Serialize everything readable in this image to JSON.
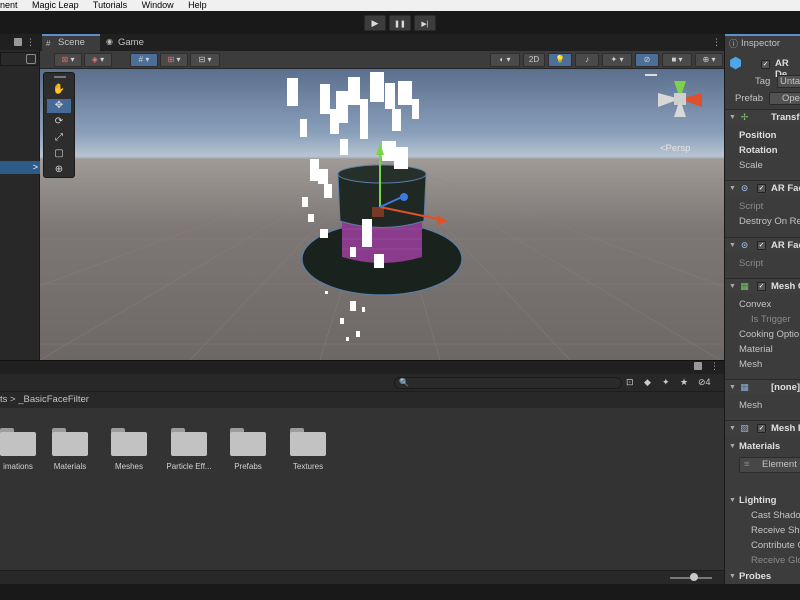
{
  "menubar": {
    "items": [
      "nent",
      "Magic Leap",
      "Tutorials",
      "Window",
      "Help"
    ]
  },
  "playbar": {
    "play_icon": "▶",
    "pause_icon": "❚❚",
    "step_icon": "▶|"
  },
  "hierarchy": {
    "selected_marker": ">"
  },
  "scene": {
    "tabs": [
      {
        "label": "Scene",
        "icon": "scene-icon"
      },
      {
        "label": "Game",
        "icon": "game-icon"
      }
    ],
    "toolbar": {
      "mode_2d": "2D"
    },
    "persp_label": "<Persp"
  },
  "tool_palette": [
    "view",
    "move",
    "rotate",
    "scale",
    "rect",
    "transform"
  ],
  "project": {
    "breadcrumb": "ts > _BasicFaceFilter",
    "search_placeholder": "",
    "visibility_count": "4",
    "folders": [
      "imations",
      "Materials",
      "Meshes",
      "Particle Eff...",
      "Prefabs",
      "Textures"
    ]
  },
  "inspector": {
    "tab_label": "Inspector",
    "object_name": "AR De",
    "tag_label": "Tag",
    "tag_value": "Unta",
    "prefab_label": "Prefab",
    "prefab_open": "Ope",
    "transform": {
      "header": "Transf",
      "position": "Position",
      "rotation": "Rotation",
      "scale": "Scale"
    },
    "ar_face_1": {
      "header": "AR Fac",
      "script": "Script",
      "destroy": "Destroy On Re"
    },
    "ar_face_2": {
      "header": "AR Fac",
      "script": "Script"
    },
    "mesh_collider": {
      "header": "Mesh C",
      "convex": "Convex",
      "is_trigger": "Is Trigger",
      "cooking": "Cooking Optio",
      "material": "Material",
      "mesh": "Mesh"
    },
    "mesh_filter": {
      "header": "[none]",
      "mesh": "Mesh"
    },
    "mesh_renderer": {
      "header": "Mesh R",
      "materials": "Materials",
      "element": "Element 0"
    },
    "lighting": {
      "header": "Lighting",
      "cast": "Cast Shado",
      "receive": "Receive Sh",
      "contribute": "Contribute G",
      "receive_gi": "Receive Glo"
    },
    "probes": {
      "header": "Probes"
    }
  },
  "colors": {
    "accent": "#4b6f98",
    "selection": "#2c5d87",
    "hat_band": "#8a3b8c",
    "hat_body": "#1f2822"
  }
}
